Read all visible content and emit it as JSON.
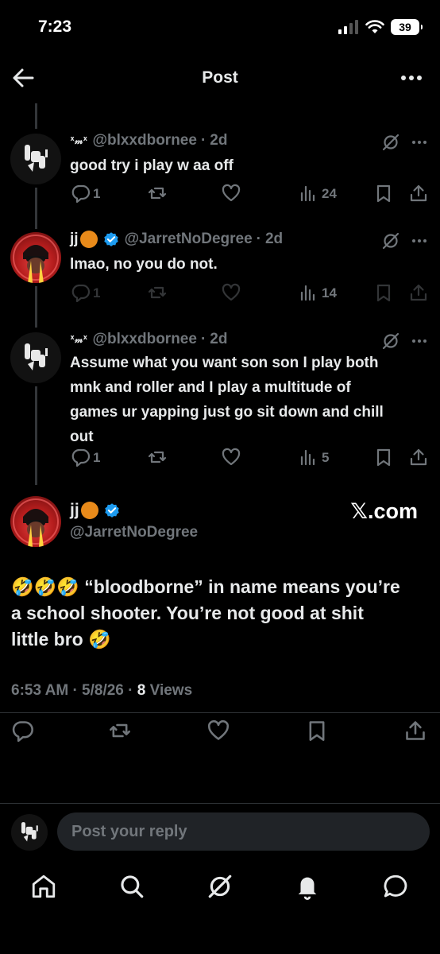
{
  "status": {
    "time": "7:23",
    "battery": "39"
  },
  "header": {
    "title": "Post"
  },
  "replies": [
    {
      "display_name": "ᕽ𝓂ᕽ",
      "handle": "@blxxdbornee",
      "age": "2d",
      "text": "good try i play w aa off",
      "replies": "1",
      "views": "24"
    },
    {
      "display_name": "jj",
      "handle": "@JarretNoDegree",
      "age": "2d",
      "text": "lmao, no you do not.",
      "replies": "1",
      "views": "14"
    },
    {
      "display_name": "ᕽ𝓂ᕽ",
      "handle": "@blxxdbornee",
      "age": "2d",
      "text_lines": [
        "Assume what you want son son I play both",
        "mnk and roller and I play a multitude of",
        "games ur yapping just go sit down and chill",
        "out"
      ],
      "replies": "1",
      "views": "5"
    }
  ],
  "main_post": {
    "display_name": "jj",
    "handle": "@JarretNoDegree",
    "watermark": "𝕏.com",
    "text_lines": [
      "🤣🤣🤣 “bloodborne” in name means you’re",
      "a school shooter. You’re not good at shit",
      "little bro 🤣"
    ],
    "time": "6:53 AM",
    "date": "5/8/26",
    "views_count": "8",
    "views_label": "Views"
  },
  "reply_bar": {
    "placeholder": "Post your reply"
  },
  "colors": {
    "background": "#000000",
    "text": "#e7e9ea",
    "muted": "#71767b",
    "verified": "#1d9bf0",
    "divider": "#2f3336"
  },
  "icons": [
    "back-arrow-icon",
    "more-icon",
    "grok-icon",
    "reply-icon",
    "retweet-icon",
    "like-icon",
    "views-icon",
    "bookmark-icon",
    "share-icon",
    "verified-icon",
    "home-icon",
    "search-icon",
    "bell-icon",
    "messages-icon"
  ]
}
